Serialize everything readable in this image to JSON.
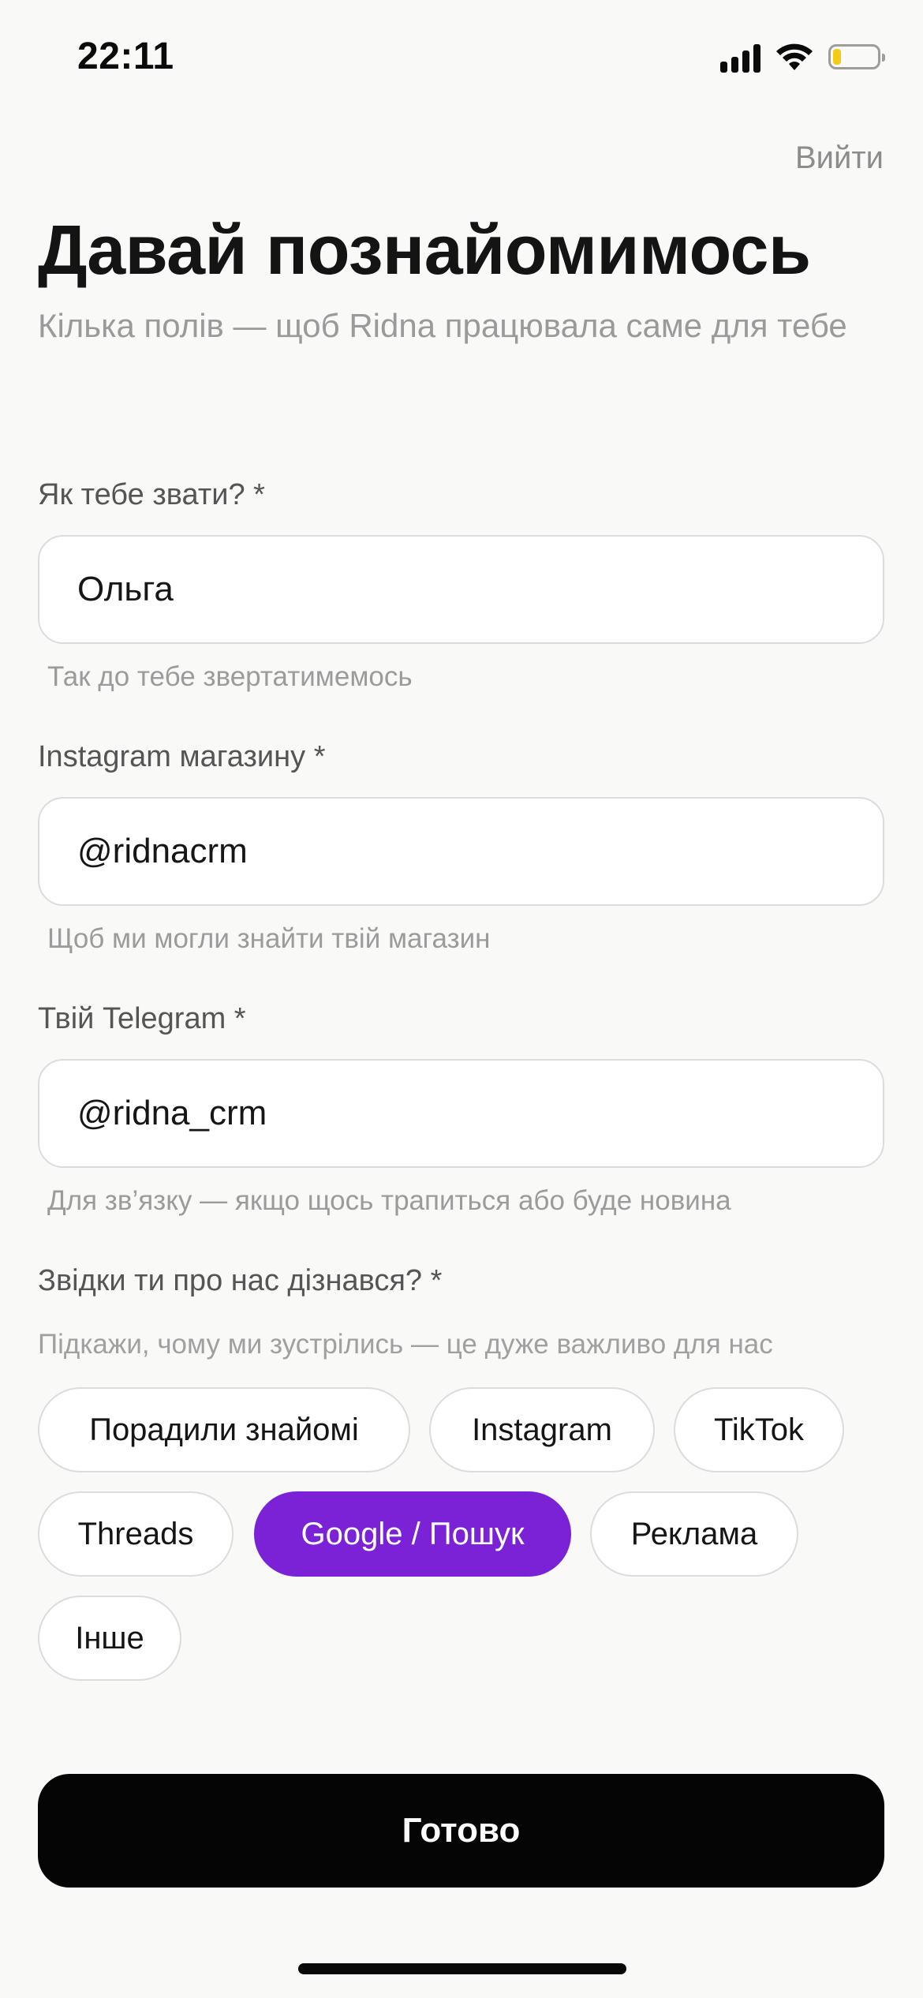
{
  "status_bar": {
    "time": "22:11",
    "signal_icon": "cellular-signal-icon",
    "wifi_icon": "wifi-icon",
    "battery_icon": "battery-low-icon",
    "battery_color": "#f5cc15"
  },
  "header": {
    "logout_label": "Вийти",
    "title": "Давай познайомимось",
    "subtitle": "Кілька полів — щоб Ridna працювала саме для тебе"
  },
  "form": {
    "name": {
      "label": "Як тебе звати? *",
      "value": "Ольга",
      "hint": "Так до тебе звертатимемось"
    },
    "instagram": {
      "label": "Instagram магазину *",
      "value": "@ridnacrm",
      "hint": "Щоб ми могли знайти твій магазин"
    },
    "telegram": {
      "label": "Твій Telegram *",
      "value": "@ridna_crm",
      "hint": "Для зв’язку — якщо щось трапиться або буде новина"
    },
    "source": {
      "label": "Звідки ти про нас дізнався? *",
      "hint": "Підкажи, чому ми зустрілись — це дуже важливо для нас",
      "options": [
        {
          "label": "Порадили знайомі",
          "selected": false
        },
        {
          "label": "Instagram",
          "selected": false
        },
        {
          "label": "TikTok",
          "selected": false
        },
        {
          "label": "Threads",
          "selected": false
        },
        {
          "label": "Google / Пошук",
          "selected": true
        },
        {
          "label": "Реклама",
          "selected": false
        },
        {
          "label": "Інше",
          "selected": false
        }
      ]
    }
  },
  "submit_label": "Готово",
  "colors": {
    "accent": "#7b22d6",
    "button": "#050505",
    "background": "#f9f9f8"
  }
}
